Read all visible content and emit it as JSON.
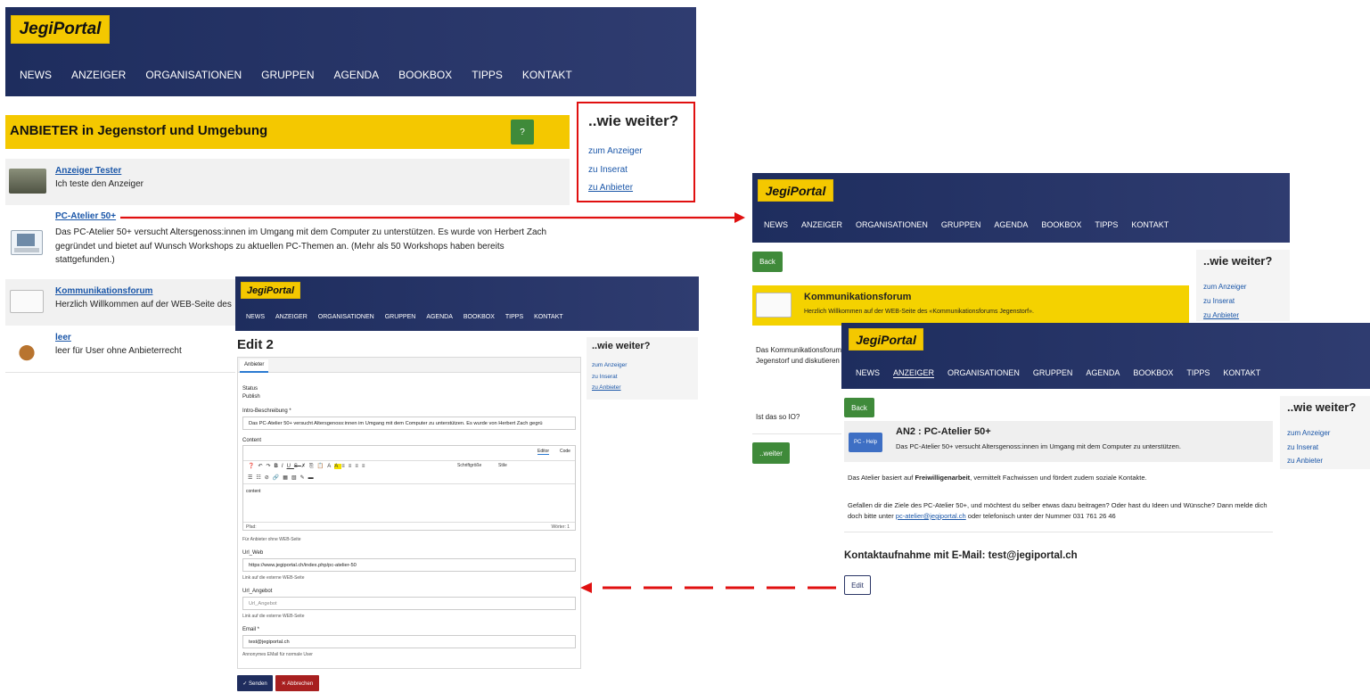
{
  "logo": "JegiPortal",
  "nav": [
    "NEWS",
    "ANZEIGER",
    "ORGANISATIONEN",
    "GRUPPEN",
    "AGENDA",
    "BOOKBOX",
    "TIPPS",
    "KONTAKT"
  ],
  "wie": {
    "title": "..wie weiter?",
    "links": [
      "zum Anzeiger",
      "zu Inserat",
      "zu Anbieter"
    ]
  },
  "main": {
    "heading": "ANBIETER in Jegenstorf und Umgebung",
    "help": "?",
    "items": [
      {
        "title": "Anzeiger Tester",
        "text": "Ich teste den Anzeiger"
      },
      {
        "title": "PC-Atelier 50+",
        "text": "Das PC-Atelier 50+ versucht Altersgenoss:innen im Umgang mit dem Computer zu unterstützen. Es wurde von Herbert Zach gegründet und bietet auf Wunsch Workshops zu aktuellen PC-Themen an. (Mehr als 50 Workshops haben bereits stattgefunden.)"
      },
      {
        "title": "Kommunikationsforum",
        "text": "Herzlich Willkommen auf der WEB-Seite des"
      },
      {
        "title": "leer",
        "text": "leer für User ohne Anbieterrecht"
      }
    ]
  },
  "edit": {
    "title": "Edit 2",
    "tab": "Anbieter",
    "status_label": "Status",
    "status_value": "Publish",
    "intro_label": "Intro-Beschreibung *",
    "intro_value": "Das PC-Atelier 50+ versucht Altersgenoss:innen im Umgang mit dem Computer zu unterstützen. Es wurde von Herbert Zach gegrü",
    "content_label": "Content",
    "editor_tab": "Editor",
    "code_tab": "Code",
    "format_select": "Schriftgröße",
    "style_select": "Stile",
    "content_value": "content",
    "path_label": "Pfad:",
    "word_count": "Wörter: 1",
    "hint_content": "Für Anbieter ohne WEB-Seite",
    "url_web_label": "Url_Web",
    "url_web_value": "https://www.jegiportal.ch/index.php/pc-atelier-50",
    "url_web_hint": "Link auf die externe WEB-Seite",
    "url_angebot_label": "Url_Angebot",
    "url_angebot_placeholder": "Url_Angebot",
    "url_angebot_hint": "Link auf die externe WEB-Seite",
    "email_label": "Email *",
    "email_value": "test@jegiportal.ch",
    "email_hint": "Annonymes EMail für normale User",
    "send": "✓ Senden",
    "cancel": "✕ Abbrechen"
  },
  "kommu": {
    "back": "Back",
    "title": "Kommunikationsforum",
    "subtitle": "Herzlich Willkommen auf der WEB-Seite des «Kommunikationsforums Jegenstorf».",
    "body1": "Das Kommunikationsforum",
    "body2": "Jegenstorf und diskutieren",
    "question": "Ist das so IO?",
    "weiter": "..weiter"
  },
  "an2": {
    "back": "Back",
    "badge": "PC - Help",
    "title": "AN2 : PC-Atelier 50+",
    "subtitle": "Das PC-Atelier 50+ versucht Altersgenoss:innen im Umgang mit dem Computer zu unterstützen.",
    "p1_a": "Das Atelier basiert auf ",
    "p1_b": "Freiwilligenarbeit",
    "p1_c": ", vermittelt Fachwissen und fördert zudem soziale Kontakte.",
    "p2_a": "Gefallen dir die Ziele des PC-Atelier 50+, und möchtest du selber etwas dazu beitragen? Oder hast du Ideen und Wünsche? Dann melde dich doch bitte unter ",
    "p2_link": "pc-atelier@jegiportal.ch",
    "p2_c": " oder telefonisch unter der Nummer 031 761 26 46",
    "contact": "Kontaktaufnahme mit E-Mail: test@jegiportal.ch",
    "edit": "Edit"
  },
  "colors": {
    "header": "#2a3566",
    "yellow": "#f4c800",
    "green": "#3f8a3a",
    "red": "#e01010",
    "darkred": "#a82020"
  }
}
